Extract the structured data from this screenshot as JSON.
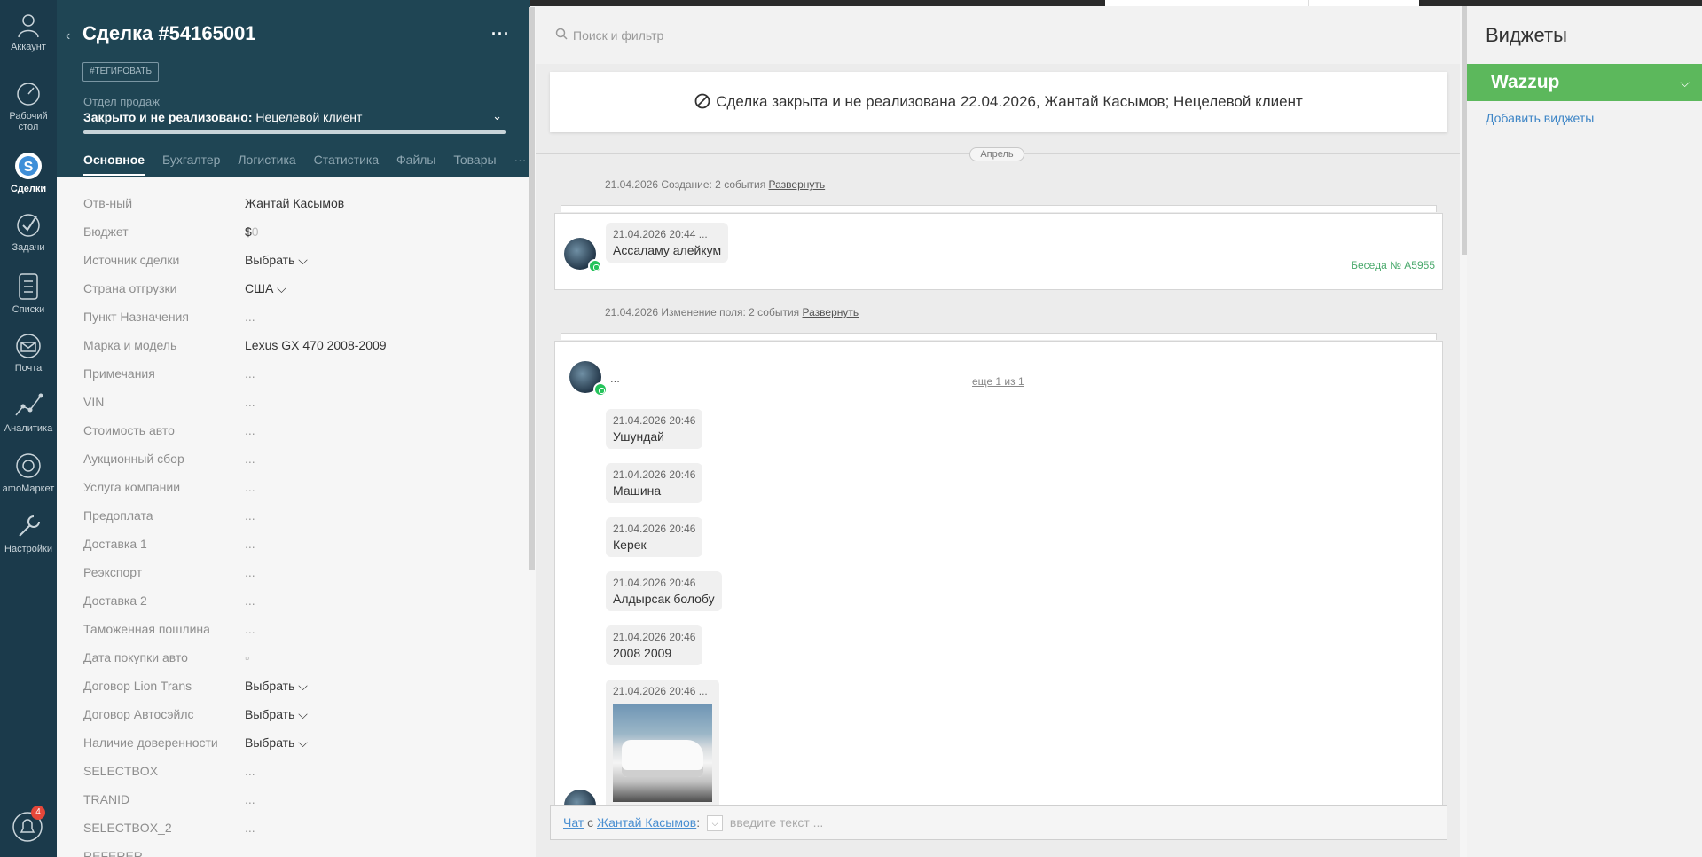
{
  "nav": {
    "items": [
      {
        "label": "Аккаунт",
        "icon": "user-icon"
      },
      {
        "label": "Рабочий стол",
        "icon": "dashboard-icon"
      },
      {
        "label": "Сделки",
        "icon": "deals-icon"
      },
      {
        "label": "Задачи",
        "icon": "tasks-icon"
      },
      {
        "label": "Списки",
        "icon": "lists-icon"
      },
      {
        "label": "Почта",
        "icon": "mail-icon"
      },
      {
        "label": "Аналитика",
        "icon": "analytics-icon"
      },
      {
        "label": "amoМаркет",
        "icon": "market-icon"
      },
      {
        "label": "Настройки",
        "icon": "settings-icon"
      }
    ],
    "notification_count": "4"
  },
  "deal": {
    "title": "Сделка #54165001",
    "tag_button": "#ТЕГИРОВАТЬ",
    "pipeline": "Отдел продаж",
    "status_bold": "Закрыто и не реализовано:",
    "status_reason": " Нецелевой клиент",
    "tabs": [
      "Основное",
      "Бухгалтер",
      "Логистика",
      "Статистика",
      "Файлы",
      "Товары",
      "···"
    ],
    "fields": [
      {
        "label": "Отв-ный",
        "value": "Жантай Касымов"
      },
      {
        "label": "Бюджет",
        "value": "$",
        "value_dim": "0"
      },
      {
        "label": "Источник сделки",
        "value": "Выбрать ⌵"
      },
      {
        "label": "Страна отгрузки",
        "value": "США ⌵"
      },
      {
        "label": "Пункт Назначения",
        "value": "..."
      },
      {
        "label": "Марка и модель",
        "value": "Lexus GX 470 2008-2009"
      },
      {
        "label": "Примечания",
        "value": "..."
      },
      {
        "label": "VIN",
        "value": "..."
      },
      {
        "label": "Стоимость авто",
        "value": "..."
      },
      {
        "label": "Аукционный сбор",
        "value": "..."
      },
      {
        "label": "Услуга компании",
        "value": "..."
      },
      {
        "label": "Предоплата",
        "value": "..."
      },
      {
        "label": "Доставка 1",
        "value": "..."
      },
      {
        "label": "Реэкспорт",
        "value": "..."
      },
      {
        "label": "Доставка 2",
        "value": "..."
      },
      {
        "label": "Таможенная пошлина",
        "value": "..."
      },
      {
        "label": "Дата покупки авто",
        "value": "▫"
      },
      {
        "label": "Договор Lion Trans",
        "value": "Выбрать ⌵"
      },
      {
        "label": "Договор Автосэйлс",
        "value": "Выбрать ⌵"
      },
      {
        "label": "Наличие довереннос­ти",
        "value": "Выбрать ⌵"
      },
      {
        "label": "SELECTBOX",
        "value": "..."
      },
      {
        "label": "TRANID",
        "value": "..."
      },
      {
        "label": "SELECTBOX_2",
        "value": "..."
      },
      {
        "label": "REFERER",
        "value": ""
      }
    ]
  },
  "feed": {
    "search_placeholder": "Поиск и фильтр",
    "closed_banner": "Сделка закрыта и не реализована 22.04.2026, Жантай Касымов; Нецелевой клиент",
    "month": "Апрель",
    "group1_text": "21.04.2026 Создание: 2 события ",
    "group1_link": "Развернуть",
    "group2_text": "21.04.2026 Изменение поля: 2 события ",
    "group2_link": "Развернуть",
    "msg1": {
      "time": "21.04.2026 20:44 ...",
      "text": "Ассаламу алейкум",
      "conversation": "Беседа № A5955"
    },
    "msg2_dots": "...",
    "more_link": "еще 1 из 1",
    "messages": [
      {
        "time": "21.04.2026 20:46",
        "text": "Ушундай"
      },
      {
        "time": "21.04.2026 20:46",
        "text": "Машина"
      },
      {
        "time": "21.04.2026 20:46",
        "text": "Керек"
      },
      {
        "time": "21.04.2026 20:46",
        "text": "Алдырсак болобу"
      },
      {
        "time": "21.04.2026 20:46",
        "text": "2008 2009"
      }
    ],
    "photo_msg_time": "21.04.2026 20:46 ...",
    "chat": {
      "chat_label": "Чат",
      "with_label": " с ",
      "contact": "Жантай Касымов",
      "colon": ":",
      "placeholder": "введите текст ..."
    }
  },
  "widgets": {
    "title": "Виджеты",
    "wazzup": "Wazzup",
    "add_widgets": "Добавить виджеты"
  },
  "colors": {
    "nav_bg": "#1b3a4b",
    "deal_header_bg": "#1f4554",
    "wazzup_green": "#5cb85c",
    "link_blue": "#3d85c6",
    "whatsapp_green": "#25c35b"
  }
}
